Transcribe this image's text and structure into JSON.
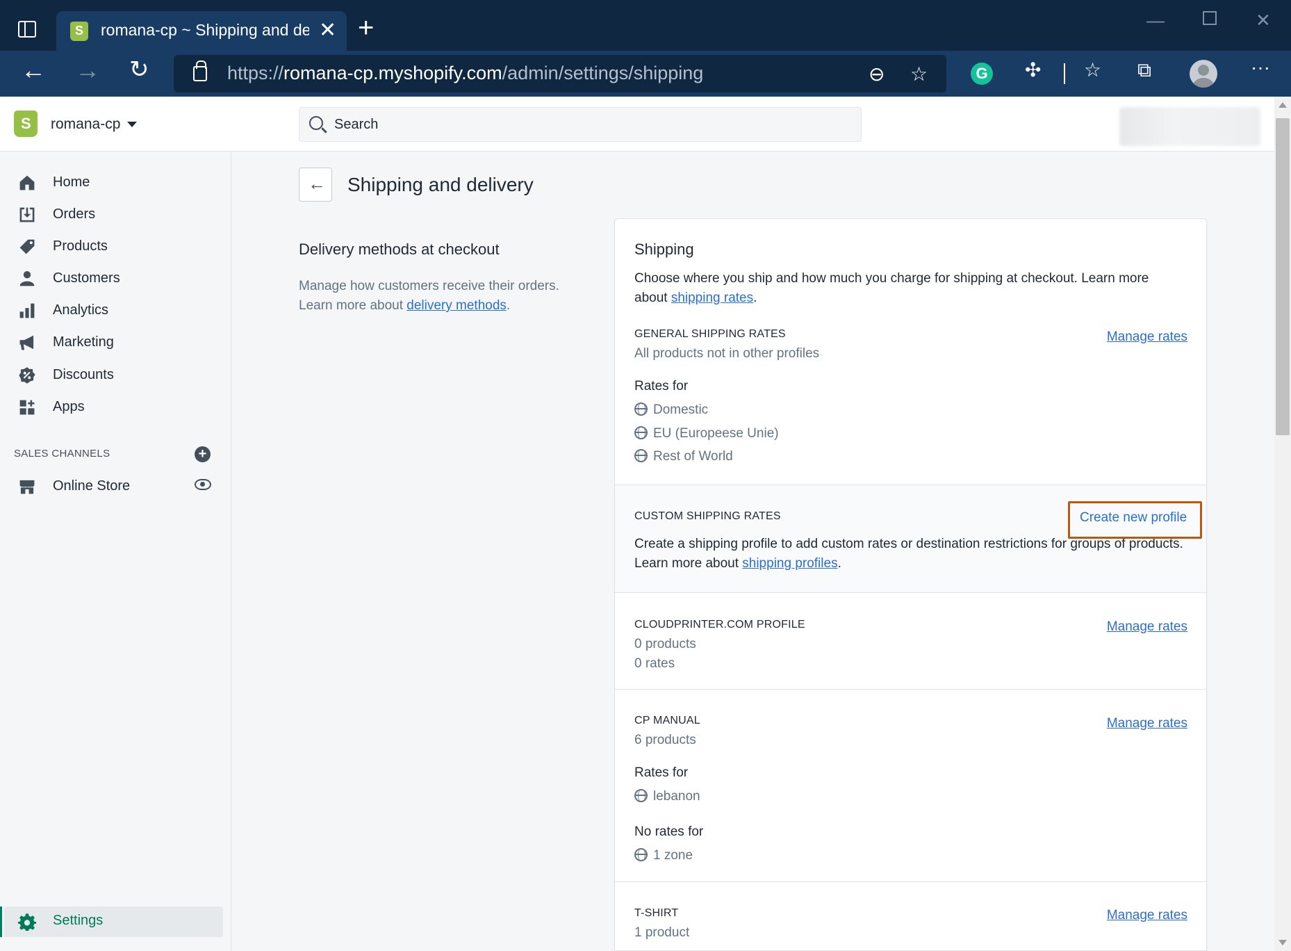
{
  "browser": {
    "tab_title": "romana-cp ~ Shipping and delivery",
    "url_proto": "https://",
    "url_host": "romana-cp.myshopify.com",
    "url_path": "/admin/settings/shipping"
  },
  "topbar": {
    "store_name": "romana-cp",
    "search_placeholder": "Search"
  },
  "sidebar": {
    "items": [
      {
        "label": "Home",
        "icon": "home-icon"
      },
      {
        "label": "Orders",
        "icon": "orders-icon"
      },
      {
        "label": "Products",
        "icon": "tag-icon"
      },
      {
        "label": "Customers",
        "icon": "person-icon"
      },
      {
        "label": "Analytics",
        "icon": "bar-chart-icon"
      },
      {
        "label": "Marketing",
        "icon": "megaphone-icon"
      },
      {
        "label": "Discounts",
        "icon": "discount-icon"
      },
      {
        "label": "Apps",
        "icon": "apps-icon"
      }
    ],
    "sales_channels_heading": "SALES CHANNELS",
    "online_store": "Online Store",
    "settings": "Settings"
  },
  "page": {
    "title": "Shipping and delivery",
    "left_title": "Delivery methods at checkout",
    "left_desc_pre": "Manage how customers receive their orders. Learn more about ",
    "left_desc_link": "delivery methods",
    "left_desc_post": "."
  },
  "card": {
    "title": "Shipping",
    "desc_pre": "Choose where you ship and how much you charge for shipping at checkout. Learn more about ",
    "desc_link": "shipping rates",
    "desc_post": ".",
    "general": {
      "heading": "GENERAL SHIPPING RATES",
      "sub": "All products not in other profiles",
      "link": "Manage rates",
      "rates_for": "Rates for",
      "zones": [
        "Domestic",
        "EU (Europeese Unie)",
        "Rest of World"
      ]
    },
    "custom": {
      "heading": "CUSTOM SHIPPING RATES",
      "button": "Create new profile",
      "desc_pre": "Create a shipping profile to add custom rates or destination restrictions for groups of products. Learn more about ",
      "desc_link": "shipping profiles",
      "desc_post": "."
    },
    "cloudprinter": {
      "heading": "CLOUDPRINTER.COM PROFILE",
      "link": "Manage rates",
      "products": "0 products",
      "rates": "0 rates"
    },
    "cp_manual": {
      "heading": "CP MANUAL",
      "link": "Manage rates",
      "products": "6 products",
      "rates_for": "Rates for",
      "zone": "lebanon",
      "no_rates_for": "No rates for",
      "no_zone": "1 zone"
    },
    "tshirt": {
      "heading": "T-SHIRT",
      "link": "Manage rates",
      "products": "1 product"
    }
  }
}
